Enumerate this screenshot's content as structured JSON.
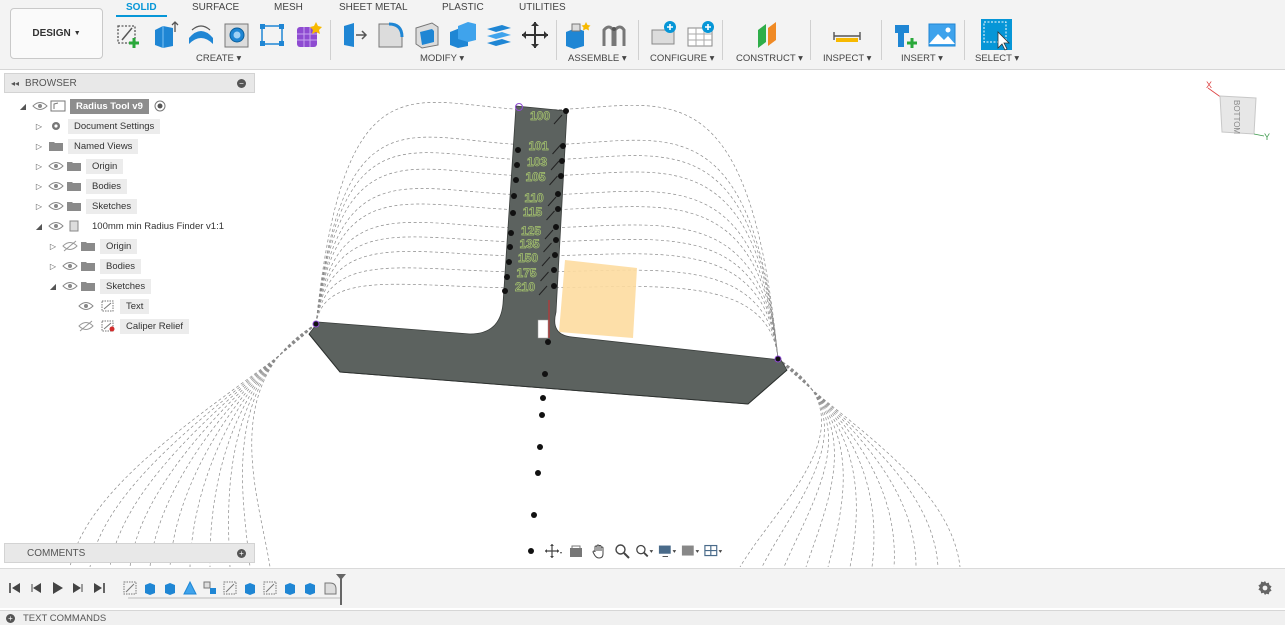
{
  "workspace": {
    "label": "DESIGN"
  },
  "tabs": [
    {
      "label": "SOLID",
      "active": true
    },
    {
      "label": "SURFACE"
    },
    {
      "label": "MESH"
    },
    {
      "label": "SHEET METAL"
    },
    {
      "label": "PLASTIC"
    },
    {
      "label": "UTILITIES"
    }
  ],
  "groups": {
    "create": "CREATE",
    "modify": "MODIFY",
    "assemble": "ASSEMBLE",
    "configure": "CONFIGURE",
    "construct": "CONSTRUCT",
    "inspect": "INSPECT",
    "insert": "INSERT",
    "select": "SELECT"
  },
  "browser": {
    "title": "BROWSER",
    "items": [
      {
        "label": "Radius Tool v9"
      },
      {
        "label": "Document Settings"
      },
      {
        "label": "Named Views"
      },
      {
        "label": "Origin"
      },
      {
        "label": "Bodies"
      },
      {
        "label": "Sketches"
      },
      {
        "label": "100mm min Radius Finder v1:1"
      },
      {
        "label": "Origin"
      },
      {
        "label": "Bodies"
      },
      {
        "label": "Sketches"
      },
      {
        "label": "Text"
      },
      {
        "label": "Caliper Relief"
      }
    ]
  },
  "comments": {
    "title": "COMMENTS"
  },
  "text_commands": {
    "title": "TEXT COMMANDS"
  },
  "viewcube": {
    "face": "BOTTOM",
    "axis_x": "X",
    "axis_y": "Y"
  },
  "model": {
    "labels": [
      "100",
      "101",
      "103",
      "105",
      "110",
      "115",
      "125",
      "135",
      "150",
      "175",
      "210"
    ]
  },
  "colors": {
    "accent": "#0696d7",
    "body": "#5c625f",
    "label_text": "#a6c46e",
    "sketch_plane": "#fddba0"
  }
}
